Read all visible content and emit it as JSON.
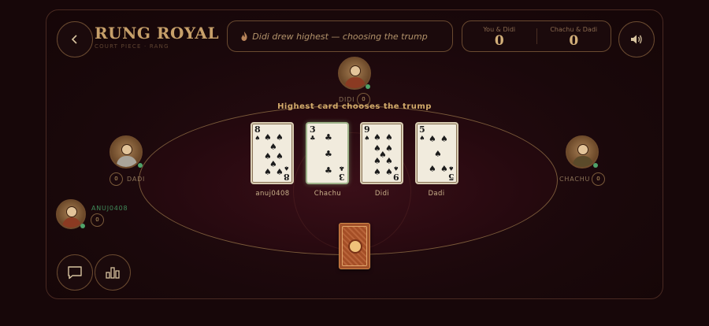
{
  "header": {
    "back_icon": "chevron-left-icon",
    "title": "RUNG ROYAL",
    "subtitle": "COURT PIECE · RANG",
    "status_message": "Didi drew highest — choosing the trump",
    "status_icon": "flame-icon",
    "sound_icon": "speaker-icon"
  },
  "score": {
    "team_a_label": "You & Didi",
    "team_a_value": "0",
    "team_b_label": "Chachu & Dadi",
    "team_b_value": "0"
  },
  "players": {
    "top": {
      "name": "DIDI",
      "tricks": "0"
    },
    "left": {
      "name": "DADI",
      "tricks": "0"
    },
    "right": {
      "name": "CHACHU",
      "tricks": "0"
    },
    "self": {
      "name": "ANUJ0408",
      "tricks": "0"
    }
  },
  "table": {
    "caption": "Highest card chooses the trump",
    "draws": [
      {
        "rank": "8",
        "suit": "♠",
        "player": "anuj0408"
      },
      {
        "rank": "3",
        "suit": "♣",
        "player": "Chachu"
      },
      {
        "rank": "9",
        "suit": "♠",
        "player": "Didi"
      },
      {
        "rank": "5",
        "suit": "♠",
        "player": "Dadi"
      }
    ],
    "deck_icon": "card-back-icon"
  },
  "footer": {
    "chat_icon": "chat-icon",
    "stats_icon": "bar-chart-icon"
  },
  "colors": {
    "background": "#170709",
    "accent_gold": "#c9a66b",
    "felt": "#2a0c12",
    "online": "#4fa36a",
    "deck": "#a2512a"
  }
}
